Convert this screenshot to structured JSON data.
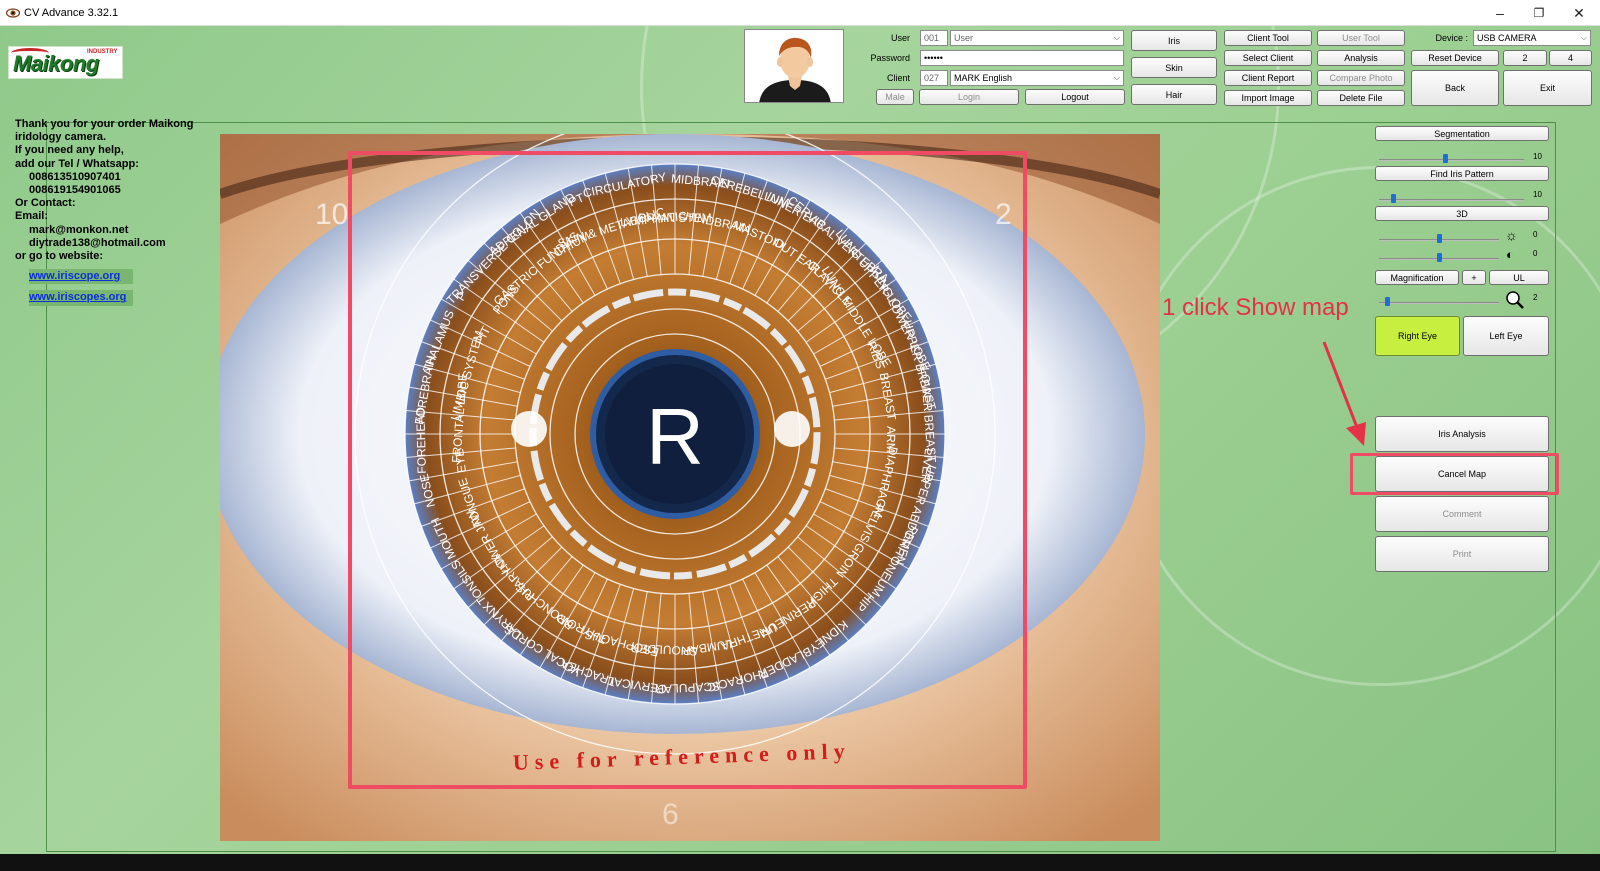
{
  "window": {
    "title": "CV Advance 3.32.1",
    "controls": {
      "minimize": "–",
      "restore": "❐",
      "close": "✕"
    }
  },
  "logo": {
    "brand": "Maikong",
    "tagline": "INDUSTRY"
  },
  "info": {
    "lines": [
      "Thank you for your order Maikong",
      "iridology camera.",
      "If you need any help,",
      "add our  Tel / Whatsapp:"
    ],
    "phones": [
      "008613510907401",
      "008619154901065"
    ],
    "contact_label": "Or Contact:",
    "email_label": "Email:",
    "emails": [
      "mark@monkon.net",
      "diytrade138@hotmail.com"
    ],
    "website_label": "or go to website:",
    "links": [
      "www.iriscope.org",
      "www.iriscopes.org"
    ]
  },
  "login": {
    "user_label": "User",
    "user_id": "001",
    "user_name": "User",
    "password_label": "Password",
    "password_value": "••••••",
    "client_label": "Client",
    "client_id": "027",
    "client_name": "MARK English",
    "gender": "Male",
    "login_button": "Login",
    "logout_button": "Logout"
  },
  "toolbar": {
    "iris": "Iris",
    "skin": "Skin",
    "hair": "Hair",
    "client_tool": "Client Tool",
    "select_client": "Select Client",
    "client_report": "Client Report",
    "import_image": "Import Image",
    "user_tool": "User Tool",
    "analysis": "Analysis",
    "compare_photo": "Compare Photo",
    "delete_file": "Delete File",
    "device_label": "Device :",
    "device_value": "USB CAMERA",
    "reset_device": "Reset Device",
    "btn_2": "2",
    "btn_4": "4",
    "back": "Back",
    "exit": "Exit"
  },
  "right_panel": {
    "segmentation": "Segmentation",
    "segmentation_value": "10",
    "find_iris_pattern": "Find Iris Pattern",
    "find_value": "10",
    "three_d": "3D",
    "brightness_value": "0",
    "contrast_value": "0",
    "magnification": "Magnification",
    "plus": "+",
    "ul": "UL",
    "zoom_value": "2",
    "right_eye": "Right Eye",
    "left_eye": "Left Eye",
    "iris_analysis": "Iris Analysis",
    "cancel_map": "Cancel Map",
    "comment": "Comment",
    "print": "Print"
  },
  "annotation": {
    "text": "1 click Show map"
  },
  "iris_map": {
    "eye_letter": "R",
    "footer_text": "Use for reference only",
    "zones": [
      "BRAIN STEM",
      "MIDBRAIN",
      "HINDBRAIN",
      "CEREBELLUM",
      "MASTOID",
      "INNER EAR",
      "OUT EAR",
      "CERVICAL VERTEBRA",
      "CLAVICLE",
      "LUNG UPPER LOBE",
      "LUNG MIDDLE LOBE",
      "LUNG LOWER LOBE",
      "RIBS",
      "UPPER BREAST",
      "BREAST",
      "LOWER BREAST",
      "ARM",
      "LIVER",
      "DIAPHRAGM",
      "UPPER ABDOMEN",
      "PELVIS",
      "PERITONEUM",
      "GROIN",
      "HIP",
      "THIGH",
      "KIDNEY",
      "PERINEUM",
      "BLADDER",
      "URETHRA",
      "THORACIC",
      "LUMBAR",
      "SCAPULAR",
      "SHOULDER",
      "CERVICAL",
      "ESOPHAGUS",
      "TRACHEA",
      "THYROID",
      "VOCAL CORDS",
      "BRONCHUS",
      "LARYNX",
      "PHARYNX",
      "TONSILS",
      "LOWER JAW",
      "MOUTH",
      "TONGUE",
      "NOSE",
      "EYE",
      "FOREHEAD",
      "FRONTAL LOBE",
      "FOREBRAIN",
      "LIMBIC SYSTEM",
      "THALAMUS",
      "PIT",
      "P",
      "PONS",
      "TRANSVERSE COLON",
      "GASTRIC FUNDUS",
      "ADRENAL GLAND",
      "CHIUM",
      "PT",
      "SKIN & METABOLIC",
      "CIRCULATORY",
      "LYMPHATIC"
    ],
    "clock_numbers": [
      "10",
      "2",
      "6"
    ]
  },
  "colors": {
    "background_green": "#9ccf92",
    "accent_red": "#ef4b64",
    "right_eye_active": "#c6ef3f",
    "link_blue": "#0b2fd6",
    "iris_brown": "#b8722a",
    "pupil_navy": "#13284a"
  }
}
